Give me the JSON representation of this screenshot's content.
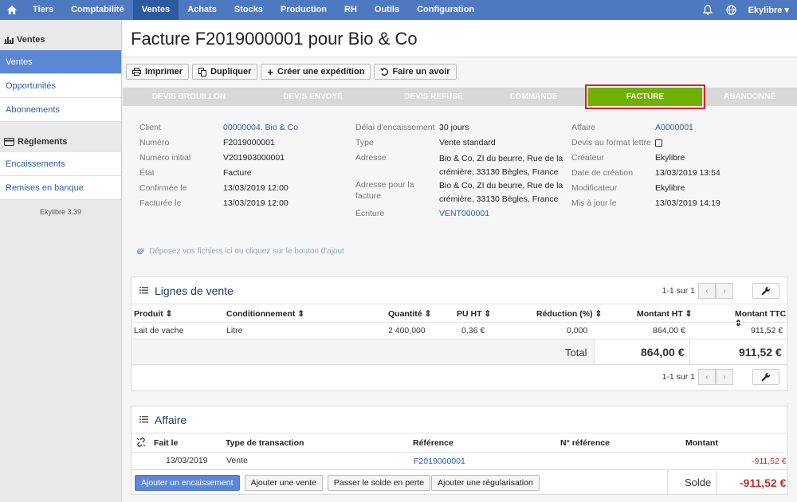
{
  "nav": {
    "items": [
      "Tiers",
      "Comptabilité",
      "Ventes",
      "Achats",
      "Stocks",
      "Production",
      "RH",
      "Outils",
      "Configuration"
    ],
    "active": "Ventes",
    "user": "Ekylibre"
  },
  "sidebar": {
    "section1": "Ventes",
    "items1": [
      "Ventes",
      "Opportunités",
      "Abonnements"
    ],
    "section2": "Règlements",
    "items2": [
      "Encaissements",
      "Remises en banque"
    ],
    "version": "Ekylibre 3.39"
  },
  "page": {
    "title": "Facture F2019000001 pour Bio & Co"
  },
  "toolbar": {
    "print": "Imprimer",
    "duplicate": "Dupliquer",
    "shipment": "Créer une expédition",
    "credit": "Faire un avoir"
  },
  "stages": [
    {
      "label": "DEVIS BROUILLON"
    },
    {
      "label": "DEVIS ENVOYÉ"
    },
    {
      "label": "DEVIS REFUSÉ"
    },
    {
      "label": "COMMANDE"
    },
    {
      "label": "FACTURE"
    },
    {
      "label": "ABANDONNÉ"
    }
  ],
  "details": {
    "client_label": "Client",
    "client": "00000004. Bio & Co",
    "number_label": "Numéro",
    "number": "F2019000001",
    "initial_label": "Numéro initial",
    "initial": "V201903000001",
    "state_label": "État",
    "state": "Facture",
    "confirmed_label": "Confirmée le",
    "confirmed": "13/03/2019 12:00",
    "invoiced_label": "Facturée le",
    "invoiced": "13/03/2019 12:00",
    "delay_label": "Délai d'encaissement",
    "delay": "30 jours",
    "type_label": "Type",
    "type": "Vente standard",
    "address_label": "Adresse",
    "address_l1": "Bio & Co, ZI du beurre, Rue de la",
    "address_l2": "crémière, 33130 Bègles, France",
    "inv_address_label": "Adresse pour la facture",
    "inv_address_l1": "Bio & Co, ZI du beurre, Rue de la",
    "inv_address_l2": "crémière, 33130 Bègles, France",
    "entry_label": "Écriture",
    "entry": "VENT000001",
    "affair_label": "Affaire",
    "affair": "A0000001",
    "letter_label": "Devis au format lettre",
    "creator_label": "Créateur",
    "creator": "Ekylibre",
    "created_label": "Date de création",
    "created": "13/03/2019 13:54",
    "modifier_label": "Modificateur",
    "modifier": "Ekylibre",
    "updated_label": "Mis à jour le",
    "updated": "13/03/2019 14:19"
  },
  "dropzone": "Déposez vos fichiers ici ou cliquez sur le bouton d'ajout",
  "lines": {
    "title": "Lignes de vente",
    "pager": "1-1 sur 1",
    "headers": {
      "product": "Produit",
      "packaging": "Conditionnement",
      "qty": "Quantité",
      "pu": "PU HT",
      "discount": "Réduction (%)",
      "ht": "Montant HT",
      "ttc": "Montant TTC"
    },
    "row": {
      "product": "Lait de vache",
      "packaging": "Litre",
      "qty": "2 400,000",
      "pu": "0,36 €",
      "discount": "0,000",
      "ht": "864,00 €",
      "ttc": "911,52 €"
    },
    "total_label": "Total",
    "total_ht": "864,00 €",
    "total_ttc": "911,52 €"
  },
  "affair": {
    "title": "Affaire",
    "headers": {
      "date": "Fait le",
      "type": "Type de transaction",
      "ref": "Référence",
      "nref": "N° référence",
      "amount": "Montant"
    },
    "row": {
      "date": "13/03/2019",
      "type": "Vente",
      "ref": "F2019000001",
      "amount": "-911,52 €"
    },
    "buttons": {
      "payment": "Ajouter un encaissement",
      "sale": "Ajouter une vente",
      "loss": "Passer le solde en perte",
      "regul": "Ajouter une régularisation"
    },
    "balance_label": "Solde",
    "balance": "-911,52 €"
  }
}
